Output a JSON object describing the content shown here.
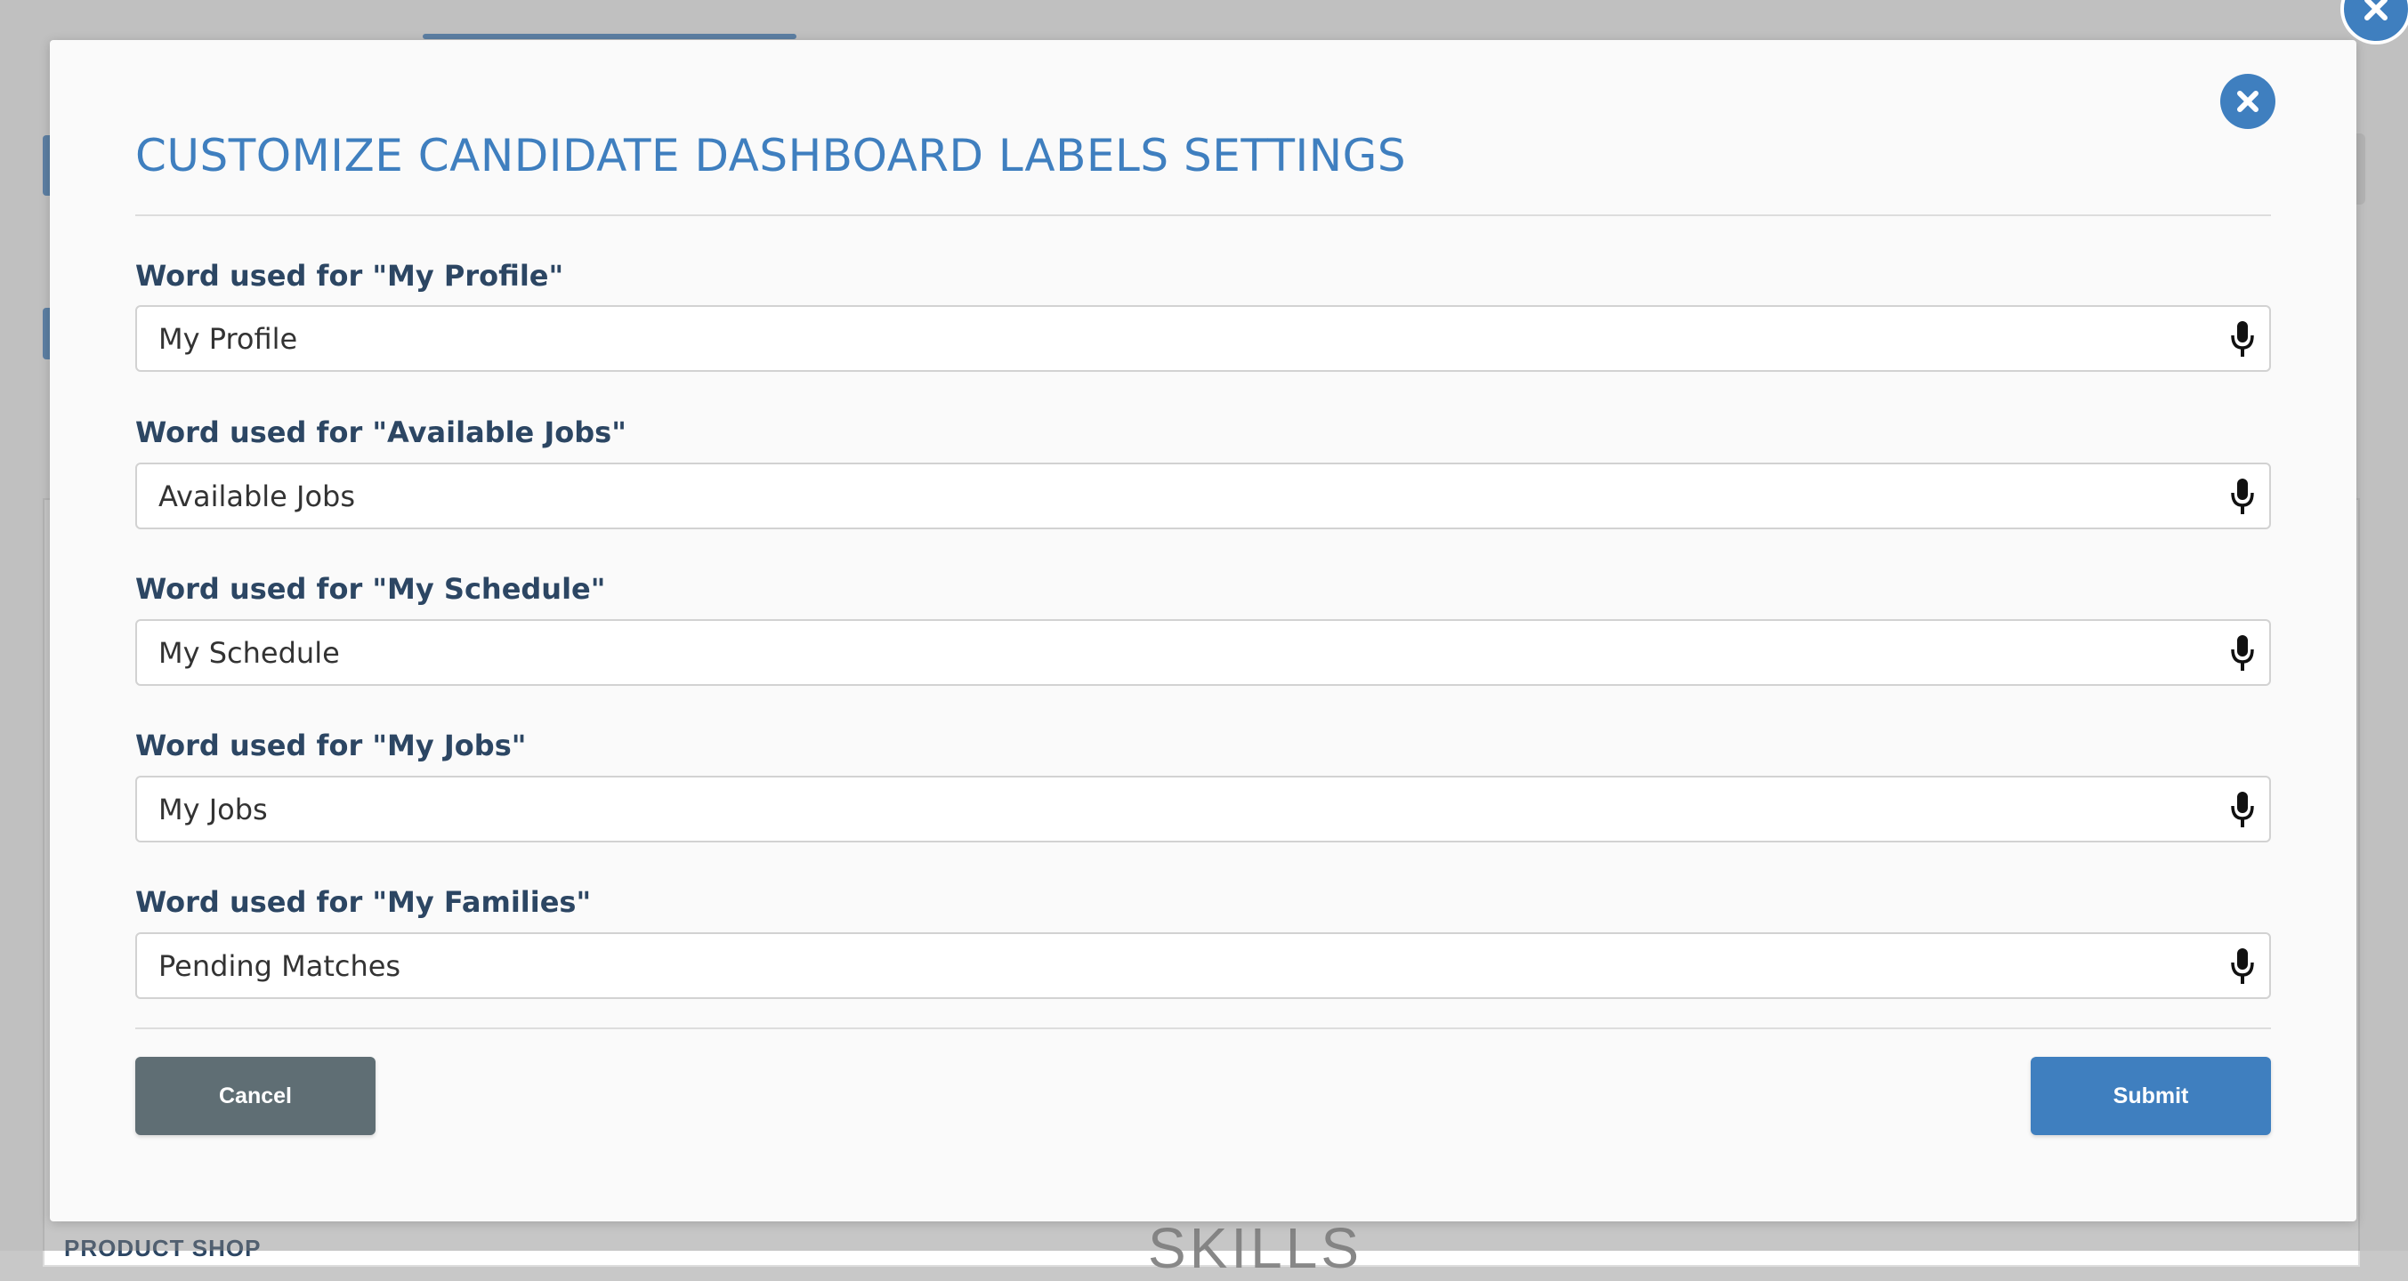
{
  "background": {
    "section_left_text": "PRODUCT SHOP",
    "section_center_text": "SKILLS"
  },
  "modal": {
    "title": "CUSTOMIZE CANDIDATE DASHBOARD LABELS SETTINGS",
    "close_icon": "close-icon",
    "fields": [
      {
        "label": "Word used for \"My Profile\"",
        "value": "My Profile",
        "icon": "microphone-icon"
      },
      {
        "label": "Word used for \"Available Jobs\"",
        "value": "Available Jobs",
        "icon": "microphone-icon"
      },
      {
        "label": "Word used for \"My Schedule\"",
        "value": "My Schedule",
        "icon": "microphone-icon"
      },
      {
        "label": "Word used for \"My Jobs\"",
        "value": "My Jobs",
        "icon": "microphone-icon"
      },
      {
        "label": "Word used for \"My Families\"",
        "value": "Pending Matches",
        "icon": "microphone-icon"
      }
    ],
    "buttons": {
      "cancel_label": "Cancel",
      "submit_label": "Submit"
    }
  },
  "colors": {
    "accent": "#3f7fbf",
    "label": "#2c4663",
    "cancel": "#5f6e74",
    "overlay": "#c8c8c8"
  }
}
